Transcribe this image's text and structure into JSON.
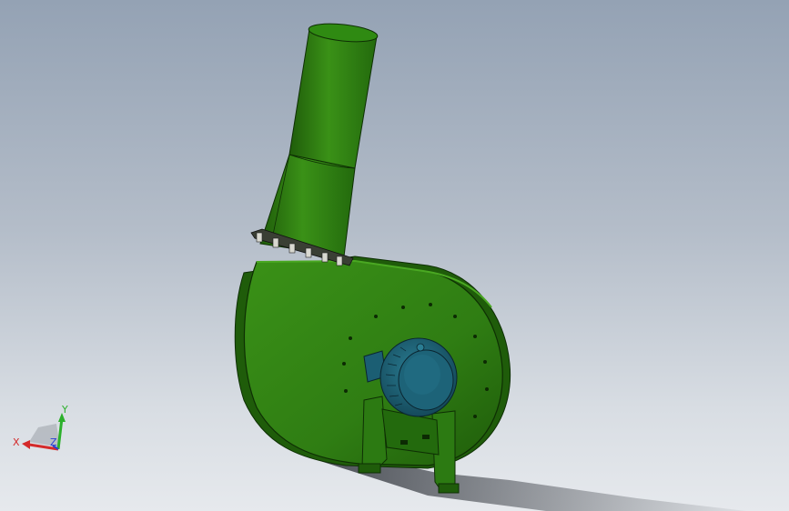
{
  "viewport": {
    "model": "centrifugal-fan-with-motor",
    "colors": {
      "background_top": "#94a2b4",
      "background_bottom": "#e6e9ed",
      "fan_body": "#2f7d13",
      "fan_body_dark": "#1f5c0a",
      "fan_body_light": "#3c9418",
      "motor": "#1b5e73",
      "motor_light": "#2a7d93",
      "shadow": "#2b2f36"
    }
  },
  "triad": {
    "x_label": "X",
    "y_label": "Y",
    "z_label": "Z",
    "x_color": "#d42a2a",
    "y_color": "#2cb02c",
    "z_color": "#2a3fd4"
  }
}
